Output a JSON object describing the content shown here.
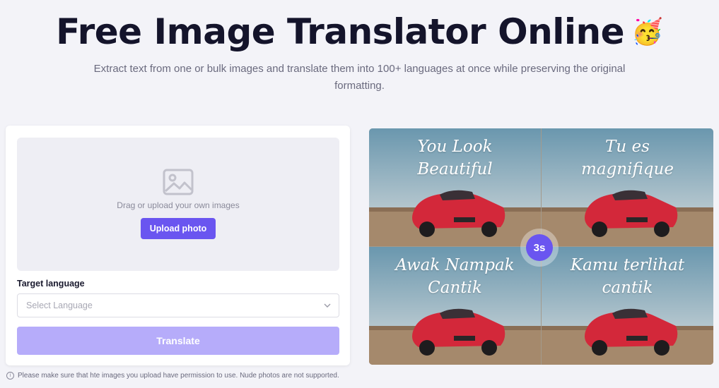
{
  "header": {
    "title": "Free Image Translator Online",
    "emoji": "🥳",
    "subtitle": "Extract text from one or bulk images and translate them into 100+ languages at once while preserving the original formatting."
  },
  "upload": {
    "drop_text": "Drag or upload your own images",
    "upload_button": "Upload photo",
    "icon": "image-icon"
  },
  "language": {
    "label": "Target language",
    "placeholder": "Select Language"
  },
  "translate_button": "Translate",
  "notice": "Please make sure that hte images you upload have permission to use. Nude photos are not supported.",
  "demo": {
    "quadrants": [
      {
        "text": "You Look\nBeautiful"
      },
      {
        "text": "Tu es\nmagnifique"
      },
      {
        "text": "Awak Nampak\nCantik"
      },
      {
        "text": "Kamu terlihat\ncantik"
      }
    ],
    "timer": "3s"
  },
  "colors": {
    "accent": "#6a55f0",
    "accent_disabled": "#b6acfa",
    "background": "#f3f3f8"
  }
}
